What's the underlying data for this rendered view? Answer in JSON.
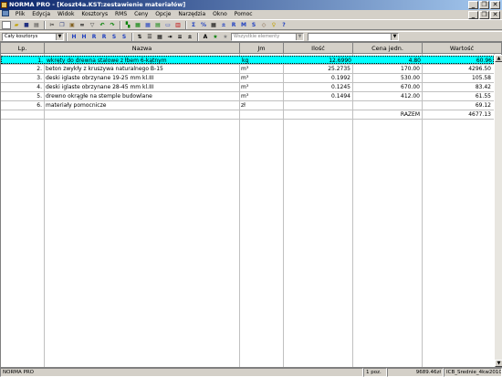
{
  "window": {
    "title": "NORMA PRO - [Koszt4a.KST:zestawienie materiałów]",
    "controls": [
      "_",
      "❐",
      "✕"
    ],
    "doc_controls": [
      "_",
      "❐",
      "✕"
    ]
  },
  "menu": [
    "Plik",
    "Edycja",
    "Widok",
    "Kosztorys",
    "RMS",
    "Ceny",
    "Opcje",
    "Narzędzia",
    "Okno",
    "Pomoc"
  ],
  "toolbar2": {
    "scope_select": "Cały kosztorys",
    "filter_select": "Wszystkie elementy",
    "right_select": ""
  },
  "table": {
    "headers": [
      "Lp.",
      "Nazwa",
      "Jm",
      "Ilość",
      "Cena jedn.",
      "Wartość"
    ],
    "rows": [
      {
        "lp": "1.",
        "nazwa": "wkręty do drewna stalowe z łbem 6-kątnym",
        "jm": "kg",
        "ilosc": "12.6990",
        "cena": "4.80",
        "wartosc": "60.96"
      },
      {
        "lp": "2.",
        "nazwa": "beton zwykły z kruszywa naturalnego B-15",
        "jm": "m³",
        "ilosc": "25.2735",
        "cena": "170.00",
        "wartosc": "4296.50"
      },
      {
        "lp": "3.",
        "nazwa": "deski iglaste obrzynane 19-25 mm kl.III",
        "jm": "m³",
        "ilosc": "0.1992",
        "cena": "530.00",
        "wartosc": "105.58"
      },
      {
        "lp": "4.",
        "nazwa": "deski iglaste obrzynane 28-45 mm kl.III",
        "jm": "m³",
        "ilosc": "0.1245",
        "cena": "670.00",
        "wartosc": "83.42"
      },
      {
        "lp": "5.",
        "nazwa": "drewno okrągłe na stemple budowlane",
        "jm": "m³",
        "ilosc": "0.1494",
        "cena": "412.00",
        "wartosc": "61.55"
      },
      {
        "lp": "6.",
        "nazwa": "materiały pomocnicze",
        "jm": "zł",
        "ilosc": "",
        "cena": "",
        "wartosc": "69.12"
      }
    ],
    "total_label": "RAZEM",
    "total_value": "4677.13"
  },
  "status": {
    "app": "NORMA PRO",
    "positions": "1 poz.",
    "sum": "9689.46zł",
    "price_list": "ICB_Srednie_4kw2010"
  },
  "colors": {
    "selected_row": "#00ffff",
    "titlebar_start": "#0a246a",
    "titlebar_end": "#a6caf0",
    "chrome": "#d4d0c8"
  }
}
